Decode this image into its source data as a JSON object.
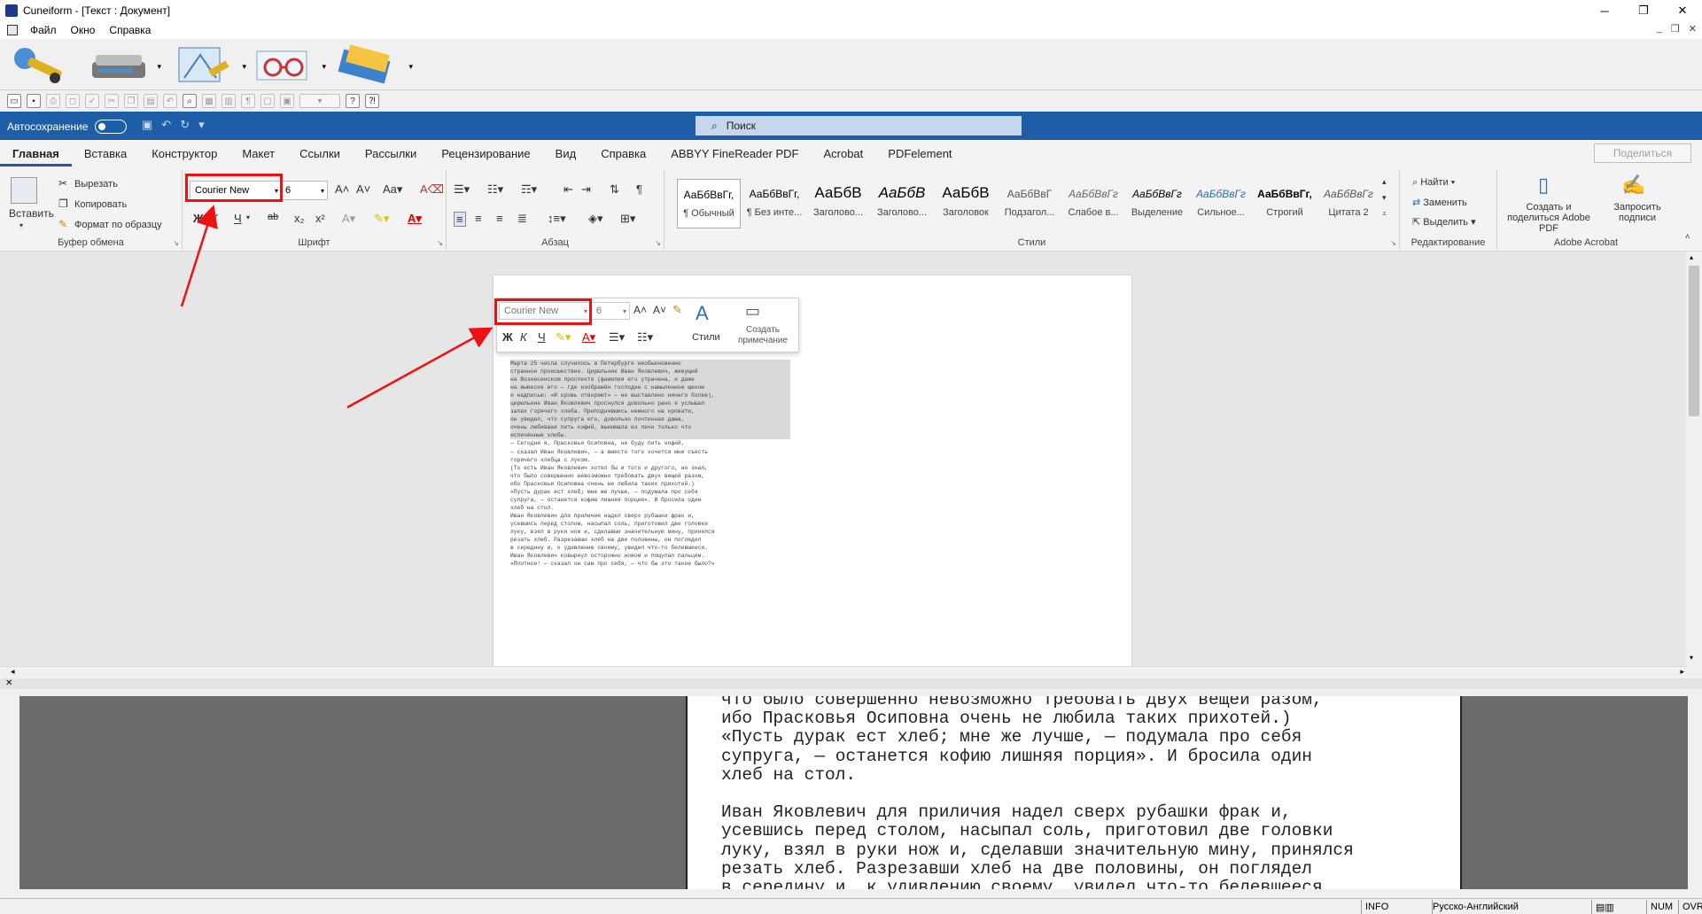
{
  "window": {
    "title": "Cuneiform - [Текст : Документ]",
    "minimize": "─",
    "maximize": "❐",
    "close": "✕"
  },
  "menu": {
    "items": [
      "Файл",
      "Окно",
      "Справка"
    ],
    "mdi_minimize": "_",
    "mdi_restore": "❐",
    "mdi_close": "✕"
  },
  "word": {
    "autosave_label": "Автосохранение",
    "search_placeholder": "Поиск",
    "tabs": [
      "Главная",
      "Вставка",
      "Конструктор",
      "Макет",
      "Ссылки",
      "Рассылки",
      "Рецензирование",
      "Вид",
      "Справка",
      "ABBYY FineReader PDF",
      "Acrobat",
      "PDFelement"
    ],
    "share_label": "Поделиться",
    "clipboard": {
      "paste": "Вставить",
      "cut": "Вырезать",
      "copy": "Копировать",
      "format_painter": "Формат по образцу",
      "group": "Буфер обмена"
    },
    "font": {
      "name": "Courier New",
      "size": "6",
      "group": "Шрифт",
      "bold": "Ж",
      "italic": "К",
      "underline": "Ч",
      "strike": "ab",
      "sub": "x₂",
      "sup": "x²"
    },
    "paragraph": {
      "group": "Абзац"
    },
    "styles": {
      "group": "Стили",
      "items": [
        {
          "sample": "АаБбВвГг,",
          "name": "¶ Обычный"
        },
        {
          "sample": "АаБбВвГг,",
          "name": "¶ Без инте..."
        },
        {
          "sample": "АаБбВ",
          "name": "Заголово..."
        },
        {
          "sample": "АаБбВ",
          "name": "Заголово..."
        },
        {
          "sample": "АаБбВ",
          "name": "Заголовок"
        },
        {
          "sample": "АаБбВвГ",
          "name": "Подзагол..."
        },
        {
          "sample": "АаБбВвГг",
          "name": "Слабое в..."
        },
        {
          "sample": "АаБбВвГг",
          "name": "Выделение"
        },
        {
          "sample": "АаБбВвГг",
          "name": "Сильное..."
        },
        {
          "sample": "АаБбВвГг,",
          "name": "Строгий"
        },
        {
          "sample": "АаБбВвГг",
          "name": "Цитата 2"
        }
      ]
    },
    "editing": {
      "group": "Редактирование",
      "find": "Найти",
      "replace": "Заменить",
      "select": "Выделить"
    },
    "acrobat": {
      "group": "Adobe Acrobat",
      "create_share": "Создать и поделиться Adobe PDF",
      "request_sign": "Запросить подписи"
    }
  },
  "minitoolbar": {
    "font": "Courier New",
    "size": "6",
    "styles": "Стили",
    "comment": "Создать примечание"
  },
  "document_lines": [
    "Марта 25 числа случилось в Петербурге необыкновенно",
    "странное происшествие. Цирюльник Иван Яковлевич, живущий",
    "на Вознесенском проспекте (фамилия его утрачена, и даже",
    "на вывеске его — где изображён господин с намыленною щекою",
    "и надписью: «И кровь отворяют» — не выставлено ничего более),",
    "цирюльник Иван Яковлевич проснулся довольно рано и услышал",
    "запах горячего хлеба. Приподнявшись немного на кровати,",
    "он увидел, что супруга его, довольно почтенная дама,",
    "очень любившая пить кофий, вынимала из печи только что",
    "испечённые хлебы.",
    "      — Сегодня я, Прасковья Осиповна, не буду пить кофий,",
    "— сказал Иван Яковлевич, — а вместо того хочется мне съесть",
    "горячего хлебца с луком.",
    "(То есть Иван Яковлевич хотел бы и того и другого, но знал,",
    "что было совершенно невозможно требовать двух вещей разом,",
    "ибо Прасковья Осиповна очень не любила таких прихотей.)",
    "«Пусть дурак ест хлеб; мне же лучше, — подумала про себя",
    "супруга, — останется кофию лишняя порция». И бросила один",
    "хлеб на стол.",
    "Иван Яковлевич для приличия надел сверх рубашки фрак и,",
    "усевшись перед столом, насыпал соль, приготовил две головки",
    "луку, взял в руки нож и, сделавши значительную мину, принялся",
    "резать хлеб. Разрезавши хлеб на две половины, он поглядел",
    "в середину и, к удивлению своему, увидел что-то белевшееся.",
    "Иван Яковлевич ковырнул осторожно ножом и пощупал пальцем.",
    "«Плотное! — сказал он сам про себя, — что бы это такое было?»"
  ],
  "bottom_text": "что было совершенно невозможно требовать двух вещей разом,\nибо Прасковья Осиповна очень не любила таких прихотей.)\n«Пусть дурак ест хлеб; мне же лучше, — подумала про себя\nсупруга, — останется кофию лишняя порция». И бросила один\nхлеб на стол.\n\nИван Яковлевич для приличия надел сверх рубашки фрак и,\nусевшись перед столом, насыпал соль, приготовил две головки\nлуку, взял в руки нож и, сделавши значительную мину, принялся\nрезать хлеб. Разрезавши хлеб на две половины, он поглядел\nв середину и, к удивлению своему, увидел что-то белевшееся.",
  "status": {
    "info": "INFO",
    "language": "Русско-Английский",
    "num": "NUM",
    "ovr": "OVR"
  }
}
